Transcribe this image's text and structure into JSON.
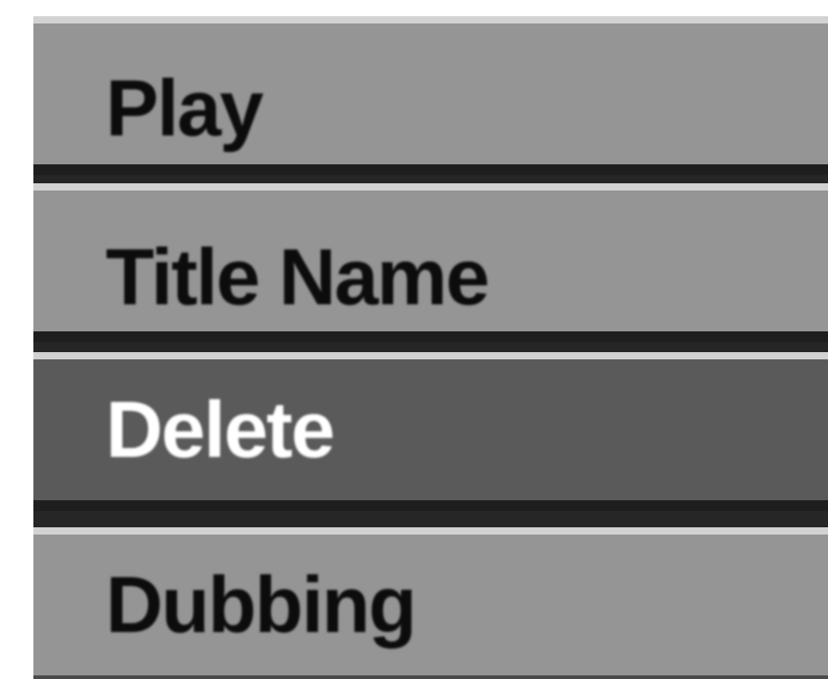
{
  "menu": {
    "items": [
      {
        "label": "Play"
      },
      {
        "label": "Title Name"
      },
      {
        "label": "Delete",
        "selected": true
      },
      {
        "label": "Dubbing"
      }
    ]
  }
}
